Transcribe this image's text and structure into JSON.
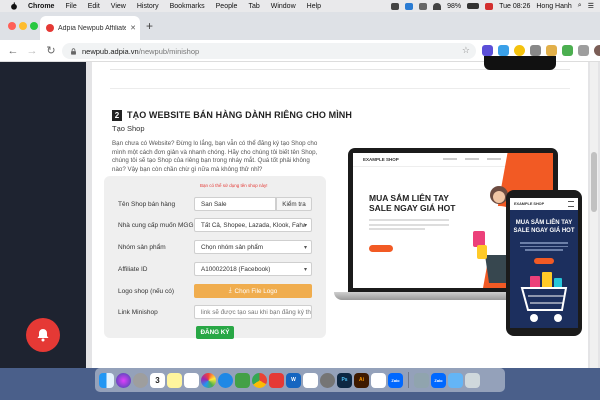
{
  "menubar": {
    "app_name": "Chrome",
    "items": [
      "File",
      "Edit",
      "View",
      "History",
      "Bookmarks",
      "People",
      "Tab",
      "Window",
      "Help"
    ],
    "battery": "98%",
    "clock": "Tue 08:26",
    "user": "Hong Hanh"
  },
  "browser": {
    "tab_title": "Adpia Newpub Affiliate Minishop",
    "url_host": "newpub.adpia.vn",
    "url_path": "/newpub/minishop"
  },
  "section": {
    "step_number": "2",
    "title": "TẠO WEBSITE BÁN HÀNG DÀNH RIÊNG CHO MÌNH",
    "subtitle": "Tạo Shop",
    "intro": "Bạn chưa có Website? Đừng lo lắng, bạn vẫn có thể đăng ký tạo Shop cho mình một cách đơn giản và nhanh chóng. Hãy cho chúng tôi biết tên Shop, chúng tôi sẽ tạo Shop của riêng bạn trong nháy mắt. Quá tốt phải không nào? Vậy bạn còn chần chừ gì nữa mà không thử nhỉ?"
  },
  "form": {
    "hint": "Bạn có thể sử dụng tên shop này!",
    "shop_name_label": "Tên Shop bán hàng",
    "shop_name_value": "San Sale",
    "check_button": "Kiểm tra",
    "provider_label": "Nhà cung cấp muốn MGG",
    "provider_value": "Tất Cả, Shopee, Lazada, Klook, Fahasa",
    "product_group_label": "Nhóm sản phẩm",
    "product_group_value": "Chọn nhóm sản phẩm",
    "affiliate_label": "Affiliate ID",
    "affiliate_value": "A100022018 (Facebook)",
    "logo_label": "Logo shop (nếu có)",
    "logo_button": "Chọn File Logo",
    "link_label": "Link Minishop",
    "link_placeholder": "link sẽ được tạo sau khi bạn đăng ký thàn",
    "submit_button": "ĐĂNG KÝ"
  },
  "mockup": {
    "laptop_brand": "EXAMPLE SHOP",
    "laptop_headline_1": "MUA SẮM LIÊN TAY",
    "laptop_headline_2": "SALE NGAY GIÁ HOT",
    "phone_brand": "EXAMPLE SHOP",
    "phone_headline_1": "MUA SẮM LIÊN TAY",
    "phone_headline_2": "SALE NGAY GIÁ HOT"
  },
  "dock": {
    "badge_calendar": "3",
    "label_word": "W",
    "label_ps": "Ps",
    "label_ai": "Ai",
    "label_zalo": "Zalo"
  },
  "colors": {
    "accent_orange": "#f25a24",
    "sidebar": "#1e2330",
    "bell": "#e53935",
    "submit_green": "#28a745",
    "upload_orange": "#f0ad4e"
  }
}
